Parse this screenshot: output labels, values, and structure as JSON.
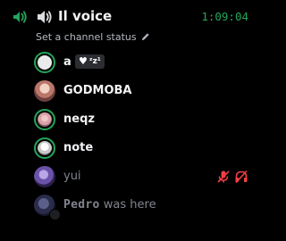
{
  "channel": {
    "name": "Il voice",
    "timer": "1:09:04",
    "status_placeholder": "Set a channel status",
    "icon": "speaker-icon",
    "connected_icon": "voice-connected-icon"
  },
  "users": [
    {
      "name": "a",
      "speaking": true,
      "badge": {
        "icon": "heart",
        "text": "ᶻz¹"
      }
    },
    {
      "name": "GODMOBA",
      "speaking": false
    },
    {
      "name": "neqz",
      "speaking": true
    },
    {
      "name": "note",
      "speaking": true
    },
    {
      "name": "yui",
      "speaking": false,
      "muted": true,
      "deafened": true
    }
  ],
  "pedro": {
    "name": "Pedro",
    "suffix": " was here"
  },
  "colors": {
    "accent_green": "#23a55a",
    "muted_red": "#f23f43",
    "text_primary": "#f2f3f5",
    "text_muted": "#80848e",
    "background": "#000000"
  }
}
